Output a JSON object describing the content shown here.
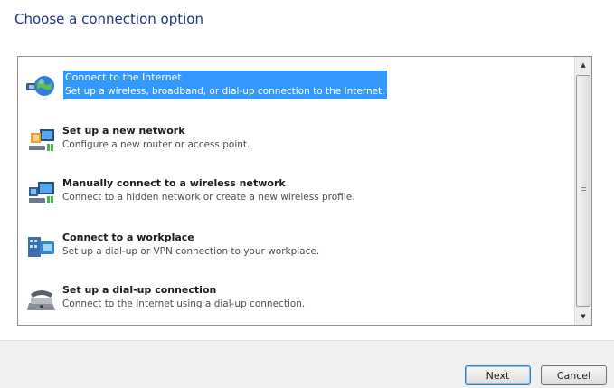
{
  "page": {
    "title": "Choose a connection option"
  },
  "options": [
    {
      "label": "Connect to the Internet",
      "description": "Set up a wireless, broadband, or dial-up connection to the Internet.",
      "icon": "globe-network-icon",
      "selected": true
    },
    {
      "label": "Set up a new network",
      "description": "Configure a new router or access point.",
      "icon": "router-network-icon",
      "selected": false
    },
    {
      "label": "Manually connect to a wireless network",
      "description": "Connect to a hidden network or create a new wireless profile.",
      "icon": "wireless-network-icon",
      "selected": false
    },
    {
      "label": "Connect to a workplace",
      "description": "Set up a dial-up or VPN connection to your workplace.",
      "icon": "workplace-vpn-icon",
      "selected": false
    },
    {
      "label": "Set up a dial-up connection",
      "description": "Connect to the Internet using a dial-up connection.",
      "icon": "dialup-phone-icon",
      "selected": false
    }
  ],
  "buttons": {
    "next": "Next",
    "cancel": "Cancel"
  },
  "colors": {
    "title": "#1e3287",
    "selection": "#3399ff"
  }
}
